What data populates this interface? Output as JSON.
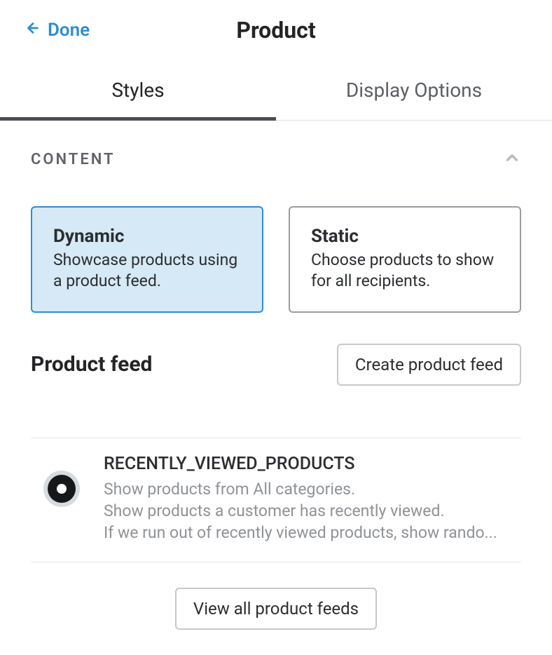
{
  "header": {
    "done": "Done",
    "title": "Product"
  },
  "tabs": {
    "styles": "Styles",
    "display_options": "Display Options"
  },
  "content": {
    "section_label": "CONTENT",
    "dynamic": {
      "title": "Dynamic",
      "desc": "Showcase products using a product feed."
    },
    "static": {
      "title": "Static",
      "desc": "Choose products to show for all recipients."
    },
    "product_feed_label": "Product feed",
    "create_feed_button": "Create product feed",
    "feed": {
      "name": "RECENTLY_VIEWED_PRODUCTS",
      "line1": "Show products from All categories.",
      "line2": "Show products a customer has recently viewed.",
      "line3": "If we run out of recently viewed products, show rando..."
    },
    "view_all_button": "View all product feeds"
  }
}
